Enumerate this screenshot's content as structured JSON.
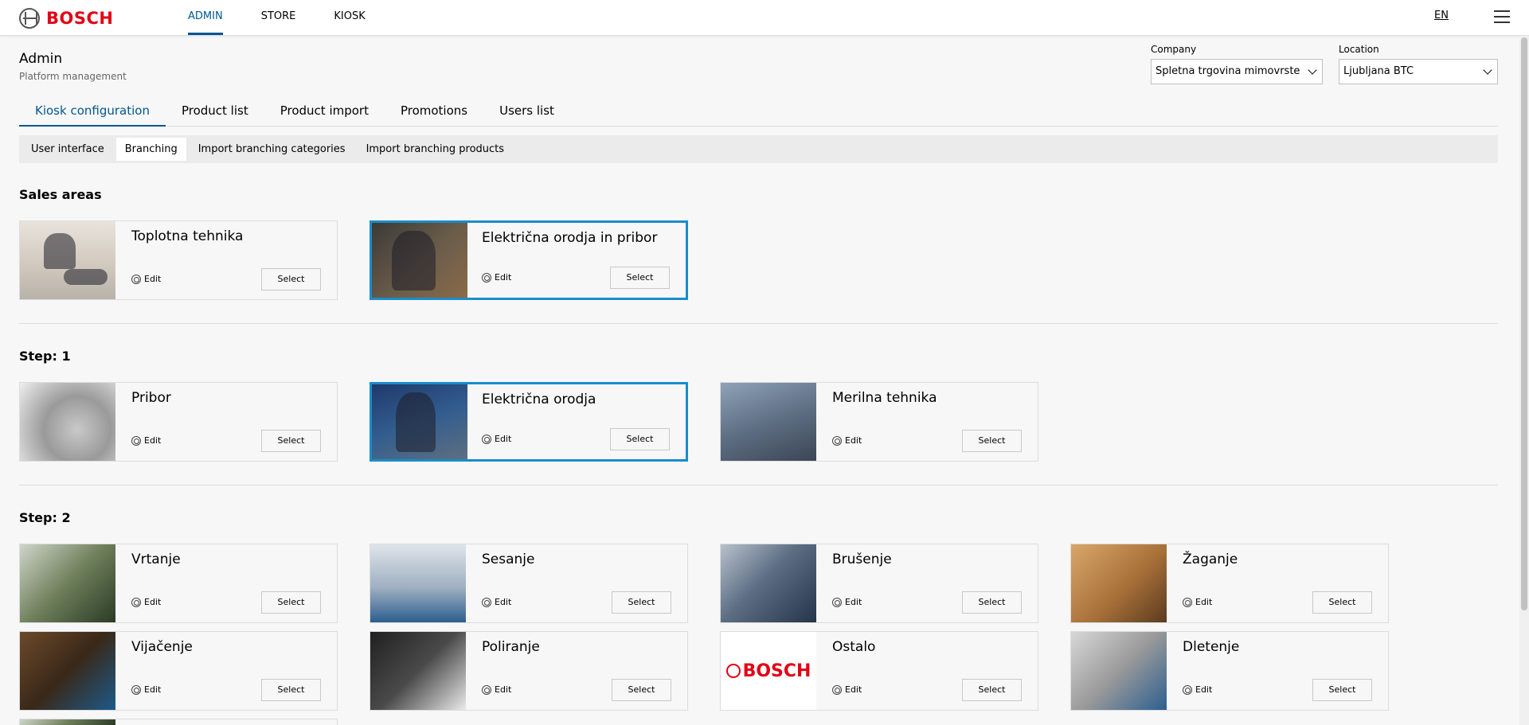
{
  "brand": {
    "name": "BOSCH"
  },
  "topnav": {
    "items": [
      "ADMIN",
      "STORE",
      "KIOSK"
    ],
    "language": "EN"
  },
  "header": {
    "title": "Admin",
    "subtitle": "Platform management"
  },
  "filters": {
    "company": {
      "label": "Company",
      "value": "Spletna trgovina mimovrste"
    },
    "location": {
      "label": "Location",
      "value": "Ljubljana BTC"
    }
  },
  "tabs": [
    "Kiosk configuration",
    "Product list",
    "Product import",
    "Promotions",
    "Users list"
  ],
  "subtabs": [
    "User interface",
    "Branching",
    "Import branching categories",
    "Import branching products"
  ],
  "labels": {
    "edit": "Edit",
    "select": "Select"
  },
  "sections": [
    {
      "title": "Sales areas",
      "cards": [
        "Toplotna tehnika",
        "Električna orodja in pribor"
      ]
    },
    {
      "title": "Step: 1",
      "cards": [
        "Pribor",
        "Električna orodja",
        "Merilna tehnika"
      ]
    },
    {
      "title": "Step: 2",
      "cards": [
        "Vrtanje",
        "Sesanje",
        "Brušenje",
        "Žaganje",
        "Vijačenje",
        "Poliranje",
        "Ostalo",
        "Dletenje"
      ]
    }
  ],
  "colors": {
    "brand_red": "#e20015",
    "accent_blue": "#005691",
    "selected_border": "#1b8ccb"
  }
}
